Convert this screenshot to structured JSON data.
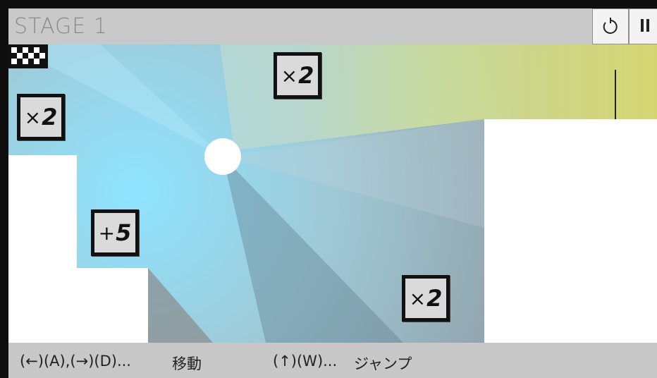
{
  "header": {
    "stage_title": "STAGE 1",
    "restart_icon": "restart-icon",
    "pause_icon": "pause-icon"
  },
  "tiles": [
    {
      "id": "tile-x2-top-left",
      "op": "×",
      "value": "2"
    },
    {
      "id": "tile-x2-top-center",
      "op": "×",
      "value": "2"
    },
    {
      "id": "tile-plus5",
      "op": "+",
      "value": "5"
    },
    {
      "id": "tile-x2-bottom-right",
      "op": "×",
      "value": "2"
    }
  ],
  "goal": {
    "icon": "checkered-flag-icon"
  },
  "player": {
    "icon": "white-ball"
  },
  "controls": {
    "move_keys": "(←)(A),(→)(D)...",
    "move_label": "移動",
    "jump_keys": "(↑)(W)...",
    "jump_label": "ジャンプ"
  },
  "colors": {
    "header_bg": "#c9c9c9",
    "footer_bg": "#c8c8c8",
    "light_cyan": "#8fe4ff",
    "light_yellow": "#e2e06a",
    "tile_bg": "#dadada"
  }
}
